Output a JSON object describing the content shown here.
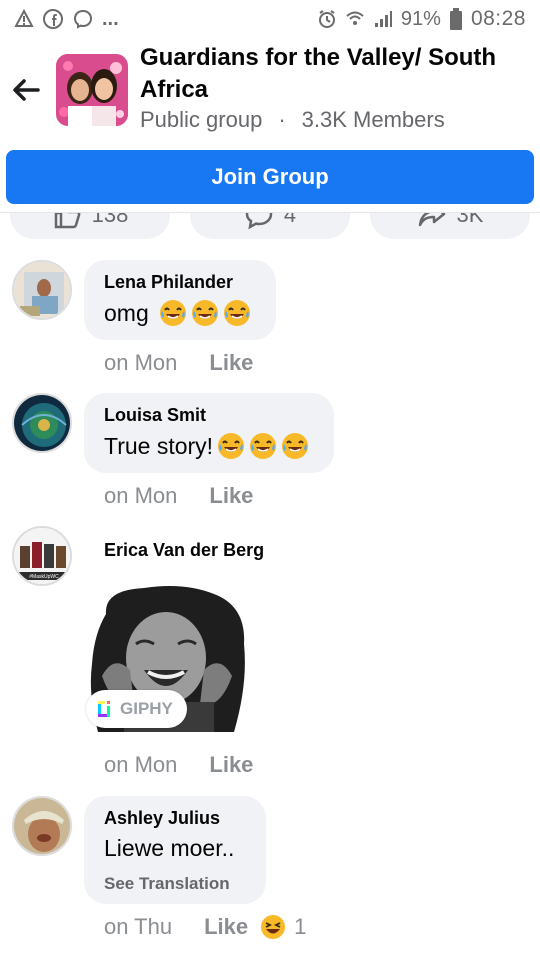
{
  "status_bar": {
    "battery": "91%",
    "time": "08:28",
    "left_icons": [
      "warning-icon",
      "facebook-icon",
      "messenger-icon",
      "more-dots"
    ],
    "right_icons": [
      "alarm-icon",
      "wifi-icon",
      "signal-icon",
      "battery-icon"
    ]
  },
  "group": {
    "name": "Guardians for the Valley/ South Africa",
    "privacy": "Public group",
    "separator": "·",
    "members": "3.3K Members"
  },
  "join_button": {
    "label": "Join Group"
  },
  "pills": [
    {
      "icon": "like-icon",
      "count": "138"
    },
    {
      "icon": "comment-icon",
      "count": "4"
    },
    {
      "icon": "share-icon",
      "count": "3K"
    }
  ],
  "comments": [
    {
      "author": "Lena Philander",
      "text": "omg",
      "emoji_count": 3,
      "time": "on Mon",
      "like_label": "Like"
    },
    {
      "author": "Louisa Smit",
      "text": "True story!",
      "emoji_count": 3,
      "time": "on Mon",
      "like_label": "Like"
    },
    {
      "author": "Erica Van der Berg",
      "giphy_label": "GIPHY",
      "avatar_tag": "#MaskUpWC",
      "time": "on Mon",
      "like_label": "Like"
    },
    {
      "author": "Ashley Julius",
      "text": "Liewe moer..",
      "translate_label": "See Translation",
      "time": "on Thu",
      "like_label": "Like",
      "reaction_count": "1"
    }
  ],
  "colors": {
    "accent": "#1877f2",
    "bubble": "#f0f2f5",
    "secondary_text": "#65676b"
  }
}
